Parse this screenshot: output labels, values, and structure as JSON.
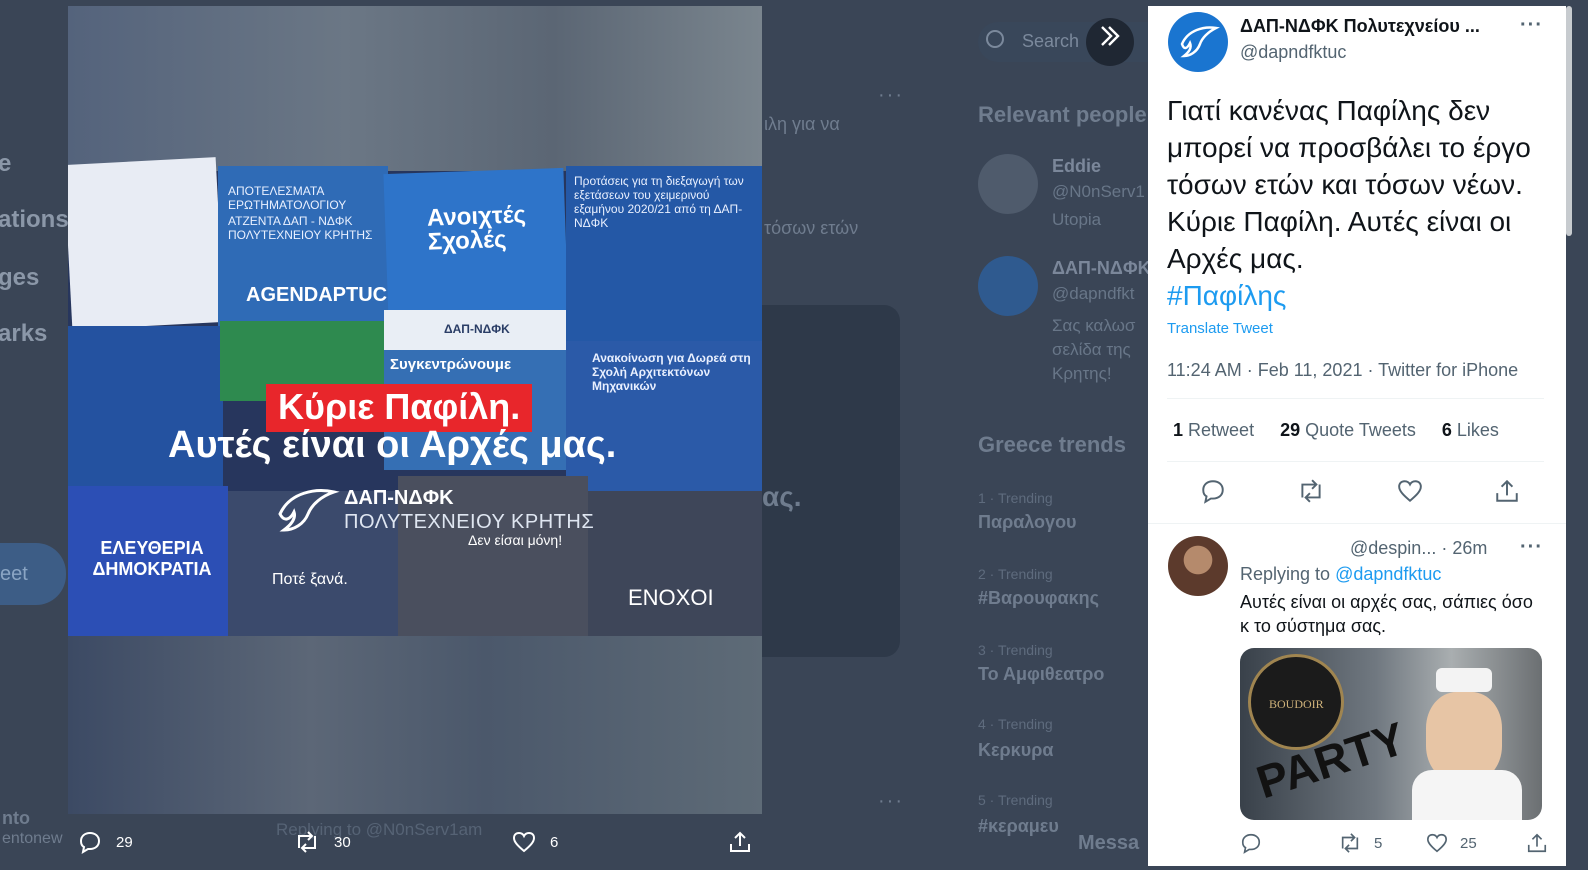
{
  "background": {
    "nav_fragments": [
      "e",
      "ations",
      "ges",
      "arks"
    ],
    "tweet_button": "eet",
    "search_placeholder": "Search",
    "relevant_people_title": "Relevant people",
    "people": [
      {
        "name": "Eddie",
        "handle": "@N0nServ1",
        "bio": "Utopia"
      },
      {
        "name": "ΔΑΠ-ΝΔΦΚ",
        "handle": "@dapndfkt",
        "bio": "Σας καλωσ σελίδα της Κρητης!"
      }
    ],
    "trends_title": "Greece trends",
    "trends": [
      {
        "meta": "1 · Trending",
        "name": "Παραλογου"
      },
      {
        "meta": "2 · Trending",
        "name": "#Βαρουφακης"
      },
      {
        "meta": "3 · Trending",
        "name": "Το Αμφιθεατρο"
      },
      {
        "meta": "4 · Trending",
        "name": "Κερκυρα"
      },
      {
        "meta": "5 · Trending",
        "name": "#κεραμευ"
      }
    ],
    "center_snippets": [
      "ιλη για να",
      "τόσων ετών",
      "ας."
    ],
    "footer_left_1": "nto",
    "footer_left_2": "entonew",
    "footer_replying": "Replying to @N0nServ1am",
    "messages_label": "Messa"
  },
  "media": {
    "overlay_line1": "Κύριε Παφίλη.",
    "overlay_line2": "Αυτές είναι οι Αρχές μας.",
    "brand_name": "ΔΑΠ-ΝΔΦΚ",
    "brand_sub": "ΠΟΛΥΤΕΧΝΕΙΟΥ ΚΡΗΤΗΣ",
    "tile_texts": {
      "agenda_title": "ΑΠΟΤΕΛΕΣΜΑΤΑ ΕΡΩΤΗΜΑΤΟΛΟΓΙΟΥ",
      "agenda_sub": "ΑΤΖΕΝΤΑ ΔΑΠ - ΝΔΦΚ ΠΟΛΥΤΕΧΝΕΙΟΥ ΚΡΗΤΗΣ",
      "agendaptuc": "AGENDAPTUC",
      "open_schools": "Ανοιχτές Σχολές",
      "proposals": "Προτάσεις για τη διεξαγωγή των εξετάσεων του χειμερινού εξαμήνου 2020/21 από τη ΔΑΠ-ΝΔΦΚ",
      "gathering": "Συγκεντρώνουμε",
      "announcement": "Ανακοίνωση για Δωρεά στη Σχολή Αρχιτεκτόνων Μηχανικών",
      "freedom": "ΕΛΕΥΘΕΡΙΑ ΔΗΜΟΚΡΑΤΙΑ",
      "never_again": "Ποτέ ξανά.",
      "not_alone": "Δεν είσαι μόνη!",
      "guilty": "ΕΝΟΧΟΙ",
      "dap_small": "ΔΑΠ-ΝΔΦΚ"
    },
    "actions": {
      "replies": "29",
      "retweets": "30",
      "likes": "6"
    }
  },
  "tweet": {
    "author_name": "ΔΑΠ-ΝΔΦΚ Πολυτεχνείου ...",
    "author_handle": "@dapndfktuc",
    "text": "Γιατί κανένας Παφίλης δεν μπορεί να προσβάλει το έργο τόσων ετών και τόσων νέων. Κύριε Παφίλη. Αυτές είναι οι Αρχές μας.",
    "hashtag": "#Παφίλης",
    "translate": "Translate Tweet",
    "timestamp": "11:24 AM · Feb 11, 2021 · Twitter for iPhone",
    "stats": {
      "retweets_count": "1",
      "retweets_label": "Retweet",
      "quotes_count": "29",
      "quotes_label": "Quote Tweets",
      "likes_count": "6",
      "likes_label": "Likes"
    }
  },
  "reply": {
    "handle_time": "@despin... · 26m",
    "replying_prefix": "Replying to",
    "replying_to": "@dapndfktuc",
    "text": "Αυτές είναι οι αρχές σας, σάπιες όσο κ το σύστημα σας.",
    "image_text_party": "PARTY",
    "image_text_boudoir": "BOUDOIR",
    "retweets": "5",
    "likes": "25"
  },
  "colors": {
    "accent": "#1d9bf0",
    "overlay_red": "#e8262b",
    "media_bg": "#27365d"
  }
}
